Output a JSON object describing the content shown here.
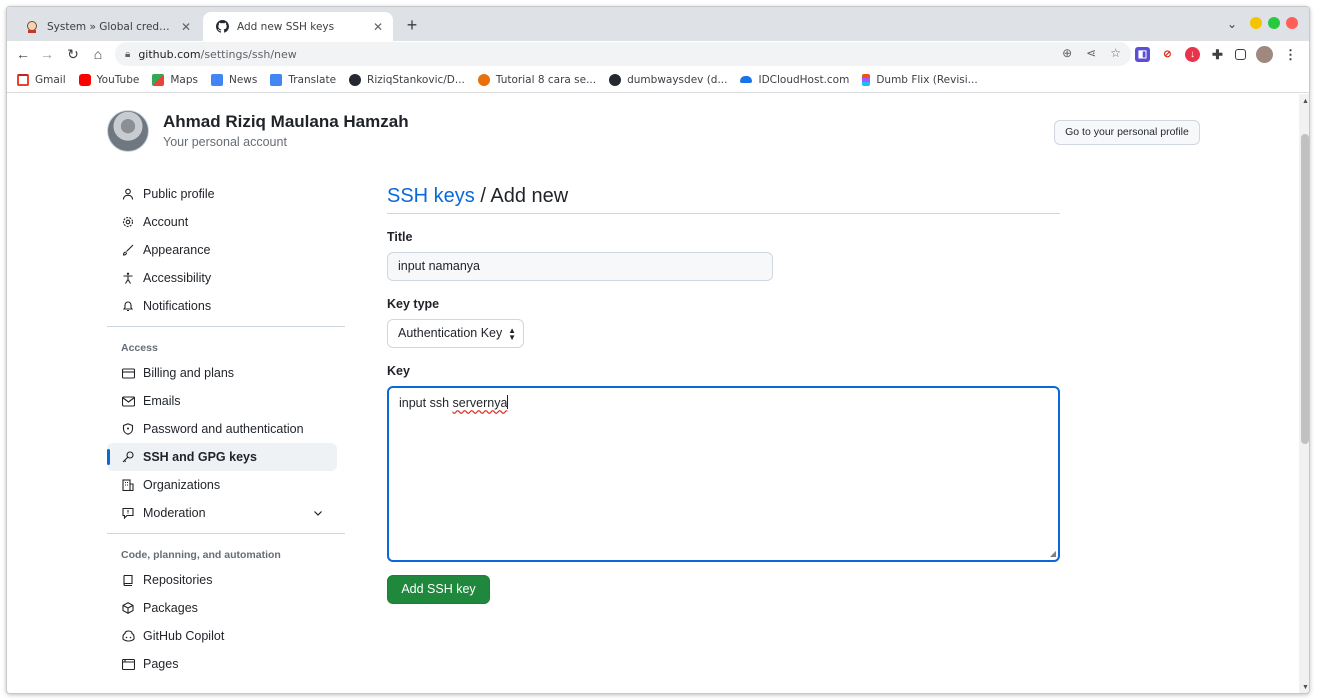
{
  "browser": {
    "tabs": [
      {
        "title": "System » Global credentials (u",
        "favicon": "jenkins-icon",
        "active": false
      },
      {
        "title": "Add new SSH keys",
        "favicon": "github-icon",
        "active": true
      }
    ],
    "new_tab_label": "+",
    "url_host": "github.com",
    "url_path": "/settings/ssh/new",
    "window_dots": [
      "#f5c400",
      "#27c93f",
      "#ff5f57"
    ]
  },
  "bookmarks": [
    {
      "label": "Gmail",
      "icon": "gmail-icon",
      "color": "#ea4335"
    },
    {
      "label": "YouTube",
      "icon": "youtube-icon",
      "color": "#ff0000"
    },
    {
      "label": "Maps",
      "icon": "maps-icon",
      "color": "#34a853"
    },
    {
      "label": "News",
      "icon": "news-icon",
      "color": "#4285f4"
    },
    {
      "label": "Translate",
      "icon": "translate-icon",
      "color": "#4285f4"
    },
    {
      "label": "RiziqStankovic/D...",
      "icon": "github-icon",
      "color": "#24292f"
    },
    {
      "label": "Tutorial 8 cara se...",
      "icon": "tutorial-icon",
      "color": "#e8710a"
    },
    {
      "label": "dumbwaysdev (d...",
      "icon": "github-icon",
      "color": "#24292f"
    },
    {
      "label": "IDCloudHost.com",
      "icon": "cloud-icon",
      "color": "#1a73e8"
    },
    {
      "label": "Dumb Flix (Revisi...",
      "icon": "figma-icon",
      "color": "#f24e1e"
    }
  ],
  "profile": {
    "name": "Ahmad Riziq Maulana Hamzah",
    "subtitle": "Your personal account",
    "profile_button": "Go to your personal profile"
  },
  "sidenav": {
    "top_items": [
      {
        "label": "Public profile",
        "icon": "person-icon"
      },
      {
        "label": "Account",
        "icon": "gear-icon"
      },
      {
        "label": "Appearance",
        "icon": "paintbrush-icon"
      },
      {
        "label": "Accessibility",
        "icon": "accessibility-icon"
      },
      {
        "label": "Notifications",
        "icon": "bell-icon"
      }
    ],
    "access_heading": "Access",
    "access_items": [
      {
        "label": "Billing and plans",
        "icon": "credit-card-icon"
      },
      {
        "label": "Emails",
        "icon": "mail-icon"
      },
      {
        "label": "Password and authentication",
        "icon": "shield-lock-icon"
      },
      {
        "label": "SSH and GPG keys",
        "icon": "key-icon"
      },
      {
        "label": "Organizations",
        "icon": "organization-icon"
      },
      {
        "label": "Moderation",
        "icon": "report-icon"
      }
    ],
    "code_heading": "Code, planning, and automation",
    "code_items": [
      {
        "label": "Repositories",
        "icon": "repo-icon"
      },
      {
        "label": "Packages",
        "icon": "package-icon"
      },
      {
        "label": "GitHub Copilot",
        "icon": "copilot-icon"
      },
      {
        "label": "Pages",
        "icon": "browser-icon"
      }
    ]
  },
  "form": {
    "breadcrumb_link": "SSH keys",
    "breadcrumb_sep": " / ",
    "breadcrumb_current": "Add new",
    "title_label": "Title",
    "title_value": "input namanya",
    "key_type_label": "Key type",
    "key_type_value": "Authentication Key",
    "key_label": "Key",
    "key_value_plain": "input ssh ",
    "key_value_misspelled": "servernya",
    "submit_label": "Add SSH key"
  }
}
